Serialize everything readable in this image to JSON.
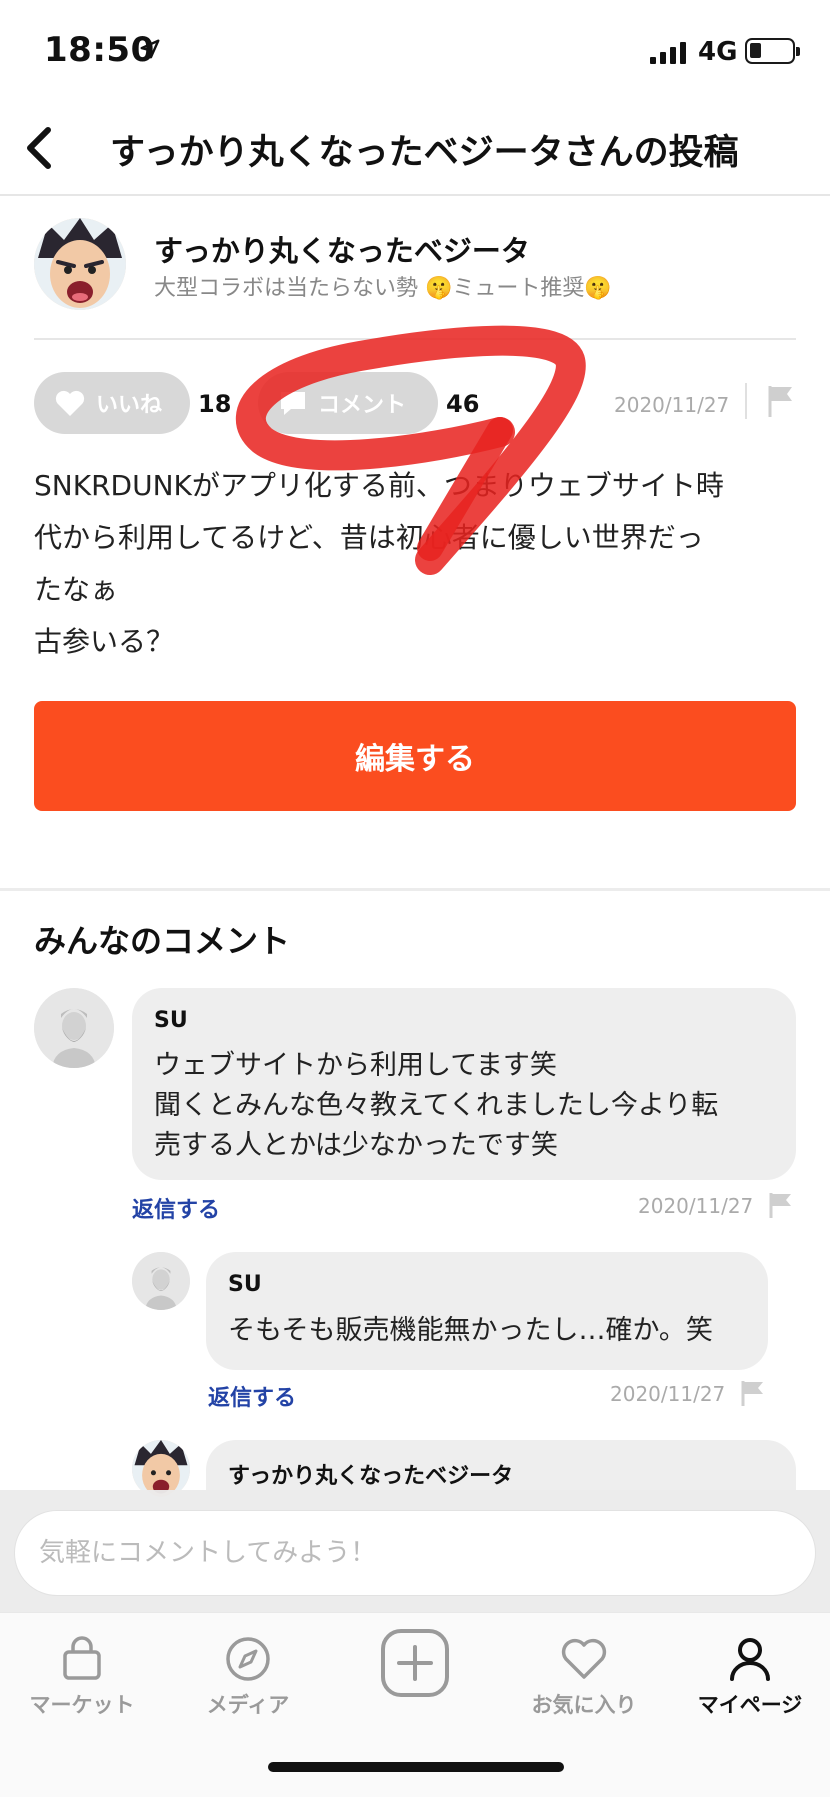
{
  "status_bar": {
    "time": "18:50",
    "network": "4G",
    "icons": [
      "location-arrow-icon",
      "signal-bars-icon",
      "battery-icon"
    ]
  },
  "header": {
    "back_icon": "chevron-left-icon",
    "title": "すっかり丸くなったベジータさんの投稿"
  },
  "post": {
    "author_name": "すっかり丸くなったベジータ",
    "author_bio": "大型コラボは当たらない勢 🤫ミュート推奨🤫",
    "like_label": "いいね",
    "like_count": "18",
    "comment_label": "コメント",
    "comment_count": "46",
    "date": "2020/11/27",
    "body_lines": [
      "SNKRDUNKがアプリ化する前、つまりウェブサイト時",
      "代から利用してるけど、昔は初心者に優しい世界だっ",
      "たなぁ",
      "古参いる？"
    ],
    "edit_button": "編集する"
  },
  "comments": {
    "section_title": "みんなのコメント",
    "items": [
      {
        "name": "SU",
        "lines": [
          "ウェブサイトから利用してます笑",
          "聞くとみんな色々教えてくれましたし今より転",
          "売する人とかは少なかったです笑"
        ],
        "reply_label": "返信する",
        "date": "2020/11/27"
      },
      {
        "name": "SU",
        "lines": [
          "そもそも販売機能無かったし…確か。笑"
        ],
        "reply_label": "返信する",
        "date": "2020/11/27"
      },
      {
        "name": "すっかり丸くなったベジータ"
      }
    ]
  },
  "comment_input": {
    "placeholder": "気軽にコメントしてみよう！"
  },
  "tabbar": {
    "items": [
      {
        "label": "マーケット",
        "icon": "shopping-bag-icon",
        "active": false
      },
      {
        "label": "メディア",
        "icon": "compass-icon",
        "active": false
      },
      {
        "label": "",
        "icon": "plus-square-icon",
        "active": false
      },
      {
        "label": "お気に入り",
        "icon": "heart-icon",
        "active": false
      },
      {
        "label": "マイページ",
        "icon": "person-icon",
        "active": true
      }
    ]
  },
  "colors": {
    "accent": "#fb4d1f",
    "link": "#2343a6",
    "annotation_red": "#e8231f",
    "pill_gray": "#d8d8d8"
  }
}
